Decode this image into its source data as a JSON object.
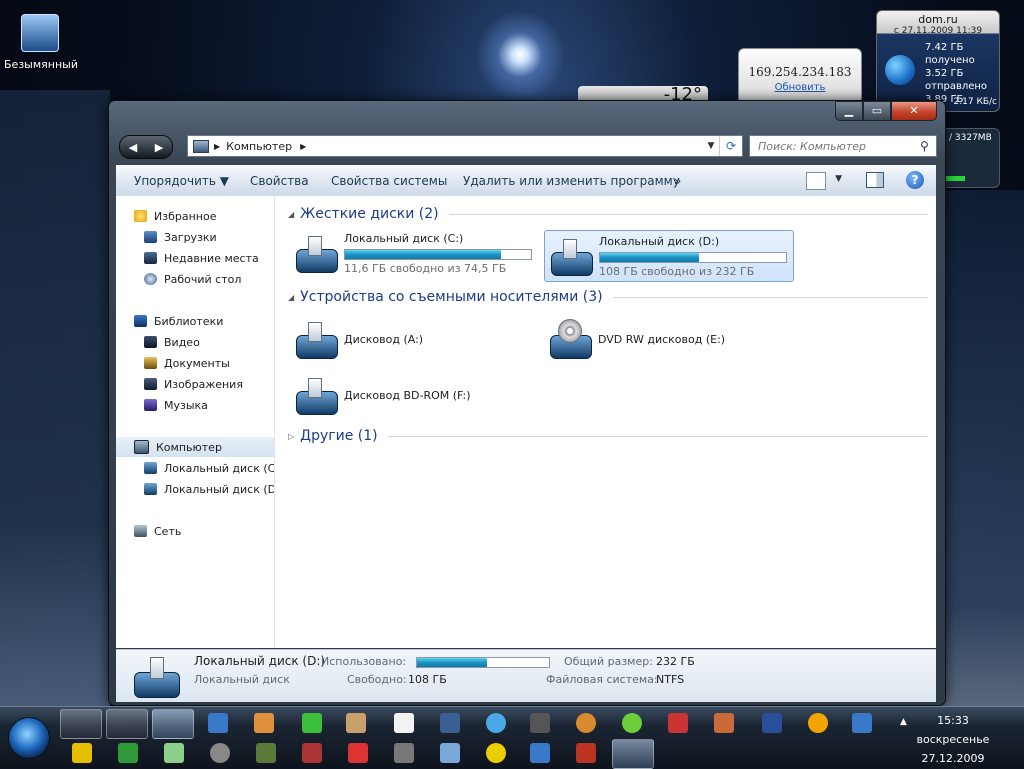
{
  "desktop": {
    "icon_label": "Безымянный"
  },
  "gadgets": {
    "ip_address": "169.254.234.183",
    "ip_refresh": "Обновить",
    "weather_temp": "-12°",
    "network": {
      "provider": "dom.ru",
      "since": "с 27.11.2009 11:39",
      "received_amount": "7.42 ГБ",
      "received_label": "получено",
      "sent_amount": "3.52 ГБ",
      "sent_label": "отправлено",
      "total": "3.89 ГБ",
      "speed": "2.17 КБ/с"
    },
    "memory": "/ 3327MB"
  },
  "window": {
    "caption_buttons": {
      "minimize": "▁",
      "maximize": "▭",
      "close": "✕"
    },
    "nav": {
      "back": "◀",
      "forward": "▶"
    },
    "address": {
      "segment": "Компьютер",
      "sep_before": "▶",
      "sep_after": "▶",
      "dropdown": "▼",
      "refresh": "⟳"
    },
    "search": {
      "placeholder": "Поиск: Компьютер",
      "icon": "search-icon"
    },
    "toolbar": {
      "organize": "Упорядочить ▼",
      "properties": "Свойства",
      "system_properties": "Свойства системы",
      "uninstall": "Удалить или изменить программу",
      "more": "»",
      "view_dropdown": "▼",
      "help": "?"
    },
    "sidebar": {
      "favorites": "Избранное",
      "downloads": "Загрузки",
      "recent": "Недавние места",
      "desktop": "Рабочий стол",
      "libraries": "Библиотеки",
      "video": "Видео",
      "documents": "Документы",
      "images": "Изображения",
      "music": "Музыка",
      "computer": "Компьютер",
      "drive_c": "Локальный диск (C:)",
      "drive_d": "Локальный диск (D:)",
      "network": "Сеть"
    },
    "groups": {
      "hard_disks": "Жесткие диски (2)",
      "removable": "Устройства со съемными носителями (3)",
      "other": "Другие (1)"
    },
    "drives": {
      "c": {
        "name": "Локальный диск (C:)",
        "free": "11,6 ГБ свободно из 74,5 ГБ",
        "used_fraction": 0.84
      },
      "d": {
        "name": "Локальный диск (D:)",
        "free": "108 ГБ свободно из 232 ГБ",
        "used_fraction": 0.53
      },
      "a": {
        "name": "Дисковод (A:)"
      },
      "e": {
        "name": "DVD RW дисковод (E:)"
      },
      "f": {
        "name": "Дисковод BD-ROM (F:)"
      }
    },
    "details": {
      "title": "Локальный диск (D:)",
      "subtitle": "Локальный диск",
      "used_label": "Использовано:",
      "free_label": "Свободно:",
      "free_value": "108 ГБ",
      "total_label": "Общий размер:",
      "total_value": "232 ГБ",
      "fs_label": "Файловая система:",
      "fs_value": "NTFS",
      "used_fraction": 0.53
    }
  },
  "taskbar": {
    "time": "15:33",
    "day": "воскресенье",
    "date": "27.12.2009",
    "tray_arrow": "▲"
  },
  "colors": {
    "accent": "#1c93c4",
    "group_header": "#1e3c8a",
    "close_button": "#c4452c"
  }
}
